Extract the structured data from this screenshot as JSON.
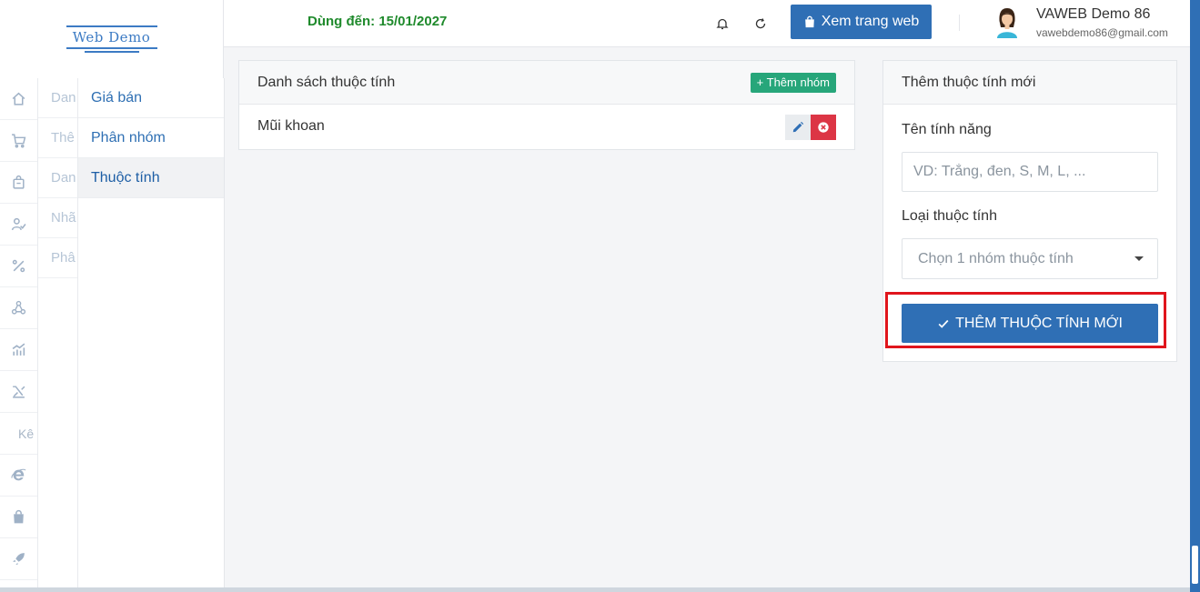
{
  "app": {
    "logo_text": "Web Demo",
    "expiry_text": "Dùng đến: 15/01/2027",
    "view_site_label": "Xem trang web",
    "user_name": "VAWEB Demo 86",
    "user_email": "vawebdemo86@gmail.com"
  },
  "sidebar": {
    "rail_icons": [
      "home-icon",
      "cart-icon",
      "bag-icon",
      "user-check-icon",
      "percent-icon",
      "network-icon",
      "chart-icon",
      "tools-icon",
      "text-ke",
      "ie-icon",
      "shopping-bag-icon",
      "rocket-icon"
    ],
    "rail_text": "Kê",
    "ghost_items": [
      "Dan",
      "Thê",
      "Dan",
      "Nhã",
      "Phâ"
    ],
    "submenu": [
      {
        "label": "Giá bán",
        "active": false
      },
      {
        "label": "Phân nhóm",
        "active": false
      },
      {
        "label": "Thuộc tính",
        "active": true
      }
    ]
  },
  "list_panel": {
    "title": "Danh sách thuộc tính",
    "add_group_label": "+ Thêm nhóm",
    "rows": [
      {
        "name": "Mũi khoan"
      }
    ]
  },
  "form_panel": {
    "title": "Thêm thuộc tính mới",
    "name_label": "Tên tính năng",
    "name_placeholder": "VD: Trắng, đen, S, M, L, ...",
    "type_label": "Loại thuộc tính",
    "type_select_value": "Chọn 1 nhóm thuộc tính",
    "submit_label": "THÊM THUỘC TÍNH MỚI"
  },
  "colors": {
    "primary": "#2f6fb5",
    "success": "#27a67a",
    "danger": "#dc3545",
    "expiry_green": "#1f8a2c",
    "highlight_red": "#e0151c"
  }
}
